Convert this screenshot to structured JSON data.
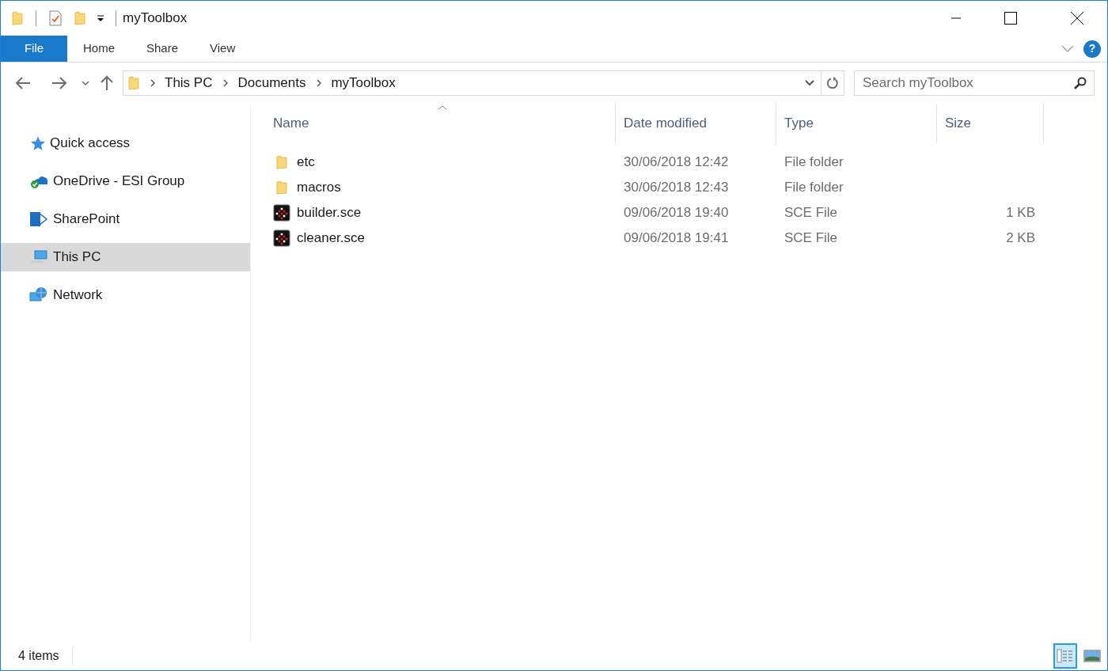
{
  "window": {
    "title": "myToolbox"
  },
  "tabs": [
    {
      "label": "File",
      "kind": "file"
    },
    {
      "label": "Home",
      "kind": "tab"
    },
    {
      "label": "Share",
      "kind": "tab"
    },
    {
      "label": "View",
      "kind": "tab"
    }
  ],
  "help": {
    "label": "?"
  },
  "address": {
    "crumbs": [
      "This PC",
      "Documents",
      "myToolbox"
    ]
  },
  "search": {
    "placeholder": "Search myToolbox"
  },
  "sidebar": {
    "items": [
      {
        "label": "Quick access",
        "kind": "star",
        "selected": false
      },
      {
        "label": "OneDrive - ESI Group",
        "kind": "cloud",
        "selected": false
      },
      {
        "label": "SharePoint",
        "kind": "sharepoint",
        "selected": false
      },
      {
        "label": "This PC",
        "kind": "pc",
        "selected": true
      },
      {
        "label": "Network",
        "kind": "network",
        "selected": false
      }
    ]
  },
  "table": {
    "columns": [
      "Name",
      "Date modified",
      "Type",
      "Size"
    ],
    "rows": [
      {
        "kind": "folder",
        "name": "etc",
        "date": "30/06/2018 12:42",
        "type": "File folder"
      },
      {
        "kind": "folder",
        "name": "macros",
        "date": "30/06/2018 12:43",
        "type": "File folder"
      },
      {
        "kind": "sce",
        "name": "builder.sce",
        "date": "09/06/2018 19:40",
        "type": "SCE File",
        "size": "1 KB"
      },
      {
        "kind": "sce",
        "name": "cleaner.sce",
        "date": "09/06/2018 19:41",
        "type": "SCE File",
        "size": "2 KB"
      }
    ]
  },
  "status_bar": {
    "text": "4 items",
    "views": [
      {
        "kind": "details",
        "selected": true
      },
      {
        "kind": "thumbnails",
        "selected": false
      }
    ]
  }
}
